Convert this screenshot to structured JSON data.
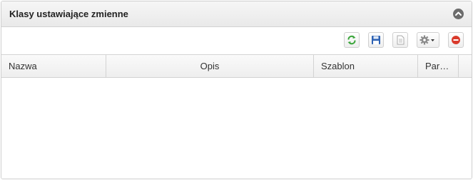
{
  "panel": {
    "title": "Klasy ustawiające zmienne"
  },
  "header": {
    "collapse_icon": "chevron-up-circle-icon"
  },
  "toolbar": {
    "buttons": [
      {
        "name": "refresh",
        "icon": "refresh-icon"
      },
      {
        "name": "save",
        "icon": "save-icon"
      },
      {
        "name": "document",
        "icon": "document-icon"
      },
      {
        "name": "settings",
        "icon": "gear-dropdown-icon"
      },
      {
        "name": "remove",
        "icon": "remove-icon"
      }
    ]
  },
  "grid": {
    "columns": [
      "Nazwa",
      "Opis",
      "Szablon",
      "Par…"
    ],
    "rows": []
  },
  "colors": {
    "refresh": "#3aa53a",
    "save": "#2f63b4",
    "remove": "#d93a2b"
  }
}
